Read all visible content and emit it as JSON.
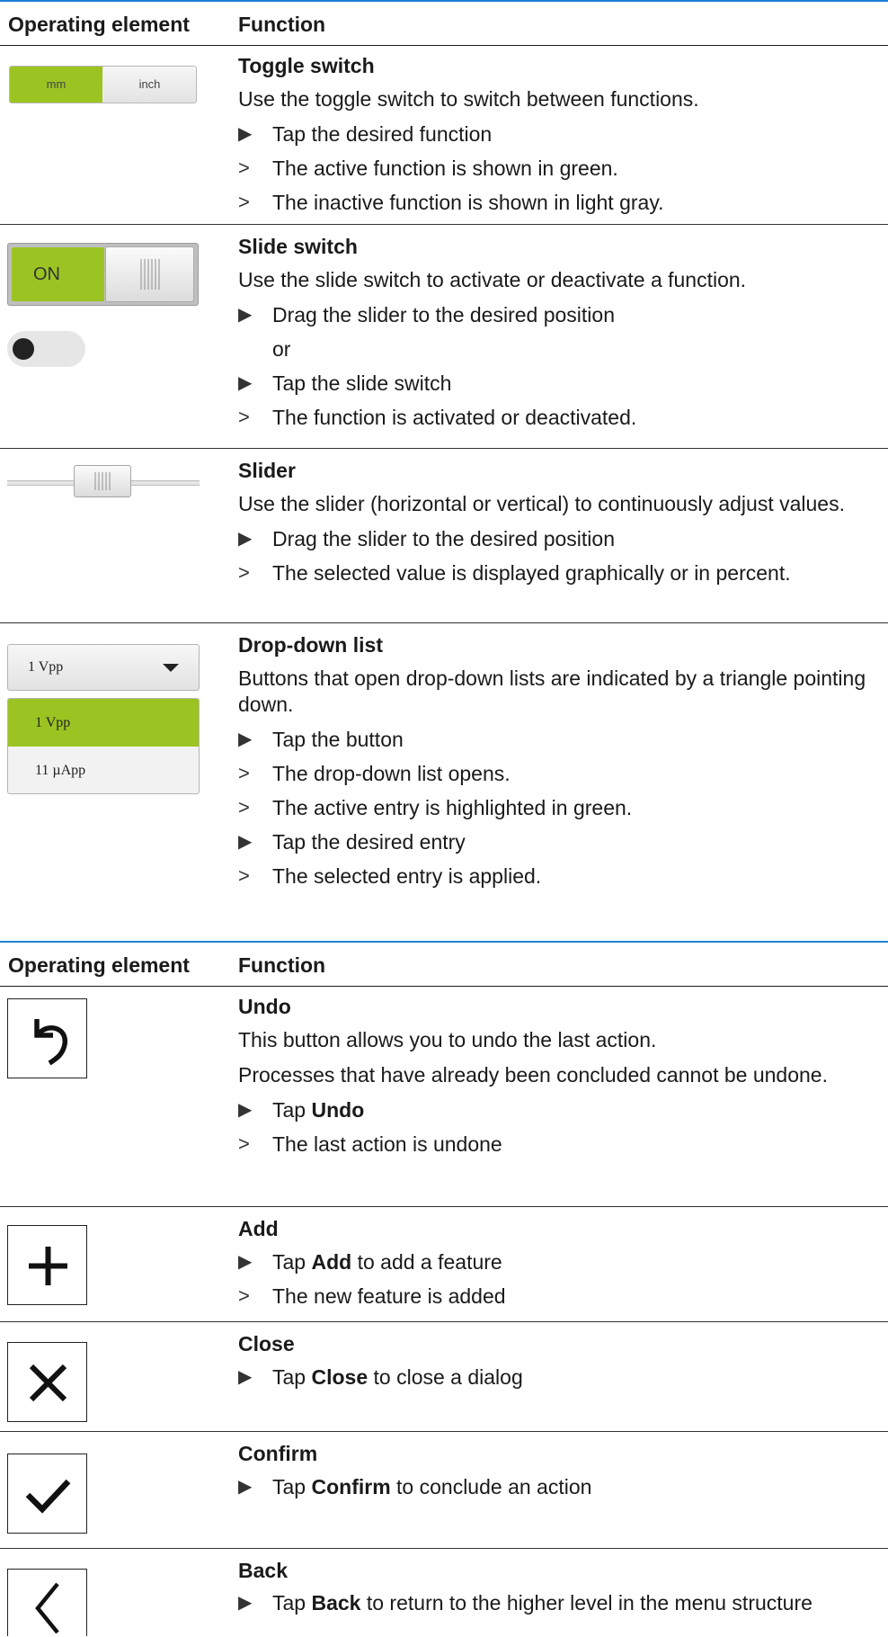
{
  "table1": {
    "header": {
      "col1": "Operating element",
      "col2": "Function"
    },
    "rows": [
      {
        "title": "Toggle switch",
        "desc": "Use the toggle switch to switch between functions.",
        "steps": [
          {
            "type": "action",
            "text": "Tap the desired function"
          },
          {
            "type": "result",
            "text": "The active function is shown in green."
          },
          {
            "type": "result",
            "text": "The inactive function is shown in light gray."
          }
        ],
        "widget": {
          "on_label": "mm",
          "off_label": "inch"
        }
      },
      {
        "title": "Slide switch",
        "desc": "Use the slide switch to activate or deactivate a function.",
        "steps": [
          {
            "type": "action",
            "text": "Drag the slider to the desired position"
          },
          {
            "type": "or",
            "text": "or"
          },
          {
            "type": "action",
            "text": "Tap the slide switch"
          },
          {
            "type": "result",
            "text": "The function is activated or deactivated."
          }
        ],
        "widget": {
          "on_label": "ON"
        }
      },
      {
        "title": "Slider",
        "desc": "Use the slider (horizontal or vertical) to continuously adjust values.",
        "steps": [
          {
            "type": "action",
            "text": "Drag the slider to the desired position"
          },
          {
            "type": "result",
            "text": "The selected value is displayed graphically or in percent."
          }
        ]
      },
      {
        "title": "Drop-down list",
        "desc": "Buttons that open drop-down lists are indicated by a triangle pointing down.",
        "steps": [
          {
            "type": "action",
            "text": "Tap the button"
          },
          {
            "type": "result",
            "text": "The drop-down list opens."
          },
          {
            "type": "result",
            "text": "The active entry is highlighted in green."
          },
          {
            "type": "action",
            "text": "Tap the desired entry"
          },
          {
            "type": "result",
            "text": "The selected entry is applied."
          }
        ],
        "widget": {
          "selected": "1 Vpp",
          "options": [
            "1 Vpp",
            "11 µApp"
          ]
        }
      }
    ]
  },
  "table2": {
    "header": {
      "col1": "Operating element",
      "col2": "Function"
    },
    "rows": [
      {
        "title": "Undo",
        "icon": "undo-icon",
        "desc": "This button allows you to undo the last action.",
        "desc2": "Processes that have already been concluded cannot be undone.",
        "step1_pre": "Tap ",
        "step1_kw": "Undo",
        "step1_post": "",
        "step2": "The last action is undone"
      },
      {
        "title": "Add",
        "icon": "plus-icon",
        "step1_pre": "Tap ",
        "step1_kw": "Add",
        "step1_post": " to add a feature",
        "step2": "The new feature is added"
      },
      {
        "title": "Close",
        "icon": "close-icon",
        "step1_pre": "Tap ",
        "step1_kw": "Close",
        "step1_post": " to close a dialog"
      },
      {
        "title": "Confirm",
        "icon": "checkmark-icon",
        "step1_pre": "Tap ",
        "step1_kw": "Confirm",
        "step1_post": " to conclude an action"
      },
      {
        "title": "Back",
        "icon": "chevron-left-icon",
        "step1_pre": "Tap ",
        "step1_kw": "Back",
        "step1_post": " to return to the higher level in the menu structure"
      }
    ]
  },
  "markers": {
    "action": "▶",
    "result": ">"
  },
  "colors": {
    "accent_green": "#9bc422",
    "header_rule": "#1f7fd2"
  }
}
